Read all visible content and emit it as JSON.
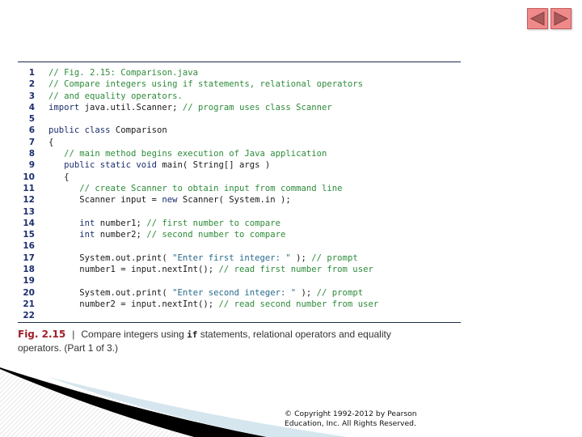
{
  "navigation": {
    "prev_icon": "triangle-left-icon",
    "next_icon": "triangle-right-icon",
    "button_color": "#f08a8a"
  },
  "code": {
    "lines": [
      {
        "n": "1",
        "tokens": [
          {
            "t": "cm",
            "v": "// Fig. 2.15: Comparison.java"
          }
        ]
      },
      {
        "n": "2",
        "tokens": [
          {
            "t": "cm",
            "v": "// Compare integers using if statements, relational operators"
          }
        ]
      },
      {
        "n": "3",
        "tokens": [
          {
            "t": "cm",
            "v": "// and equality operators."
          }
        ]
      },
      {
        "n": "4",
        "tokens": [
          {
            "t": "kw",
            "v": "import"
          },
          {
            "t": "tx",
            "v": " java.util.Scanner; "
          },
          {
            "t": "cm",
            "v": "// program uses class Scanner"
          }
        ]
      },
      {
        "n": "5",
        "tokens": []
      },
      {
        "n": "6",
        "tokens": [
          {
            "t": "kw",
            "v": "public class"
          },
          {
            "t": "tx",
            "v": " Comparison"
          }
        ]
      },
      {
        "n": "7",
        "tokens": [
          {
            "t": "tx",
            "v": "{"
          }
        ]
      },
      {
        "n": "8",
        "tokens": [
          {
            "t": "tx",
            "v": "   "
          },
          {
            "t": "cm",
            "v": "// main method begins execution of Java application"
          }
        ]
      },
      {
        "n": "9",
        "tokens": [
          {
            "t": "tx",
            "v": "   "
          },
          {
            "t": "kw",
            "v": "public static void"
          },
          {
            "t": "tx",
            "v": " main( String[] args )"
          }
        ]
      },
      {
        "n": "10",
        "tokens": [
          {
            "t": "tx",
            "v": "   {"
          }
        ]
      },
      {
        "n": "11",
        "tokens": [
          {
            "t": "tx",
            "v": "      "
          },
          {
            "t": "cm",
            "v": "// create Scanner to obtain input from command line"
          }
        ]
      },
      {
        "n": "12",
        "tokens": [
          {
            "t": "tx",
            "v": "      Scanner input = "
          },
          {
            "t": "kw",
            "v": "new"
          },
          {
            "t": "tx",
            "v": " Scanner( System.in );"
          }
        ]
      },
      {
        "n": "13",
        "tokens": []
      },
      {
        "n": "14",
        "tokens": [
          {
            "t": "tx",
            "v": "      "
          },
          {
            "t": "kw",
            "v": "int"
          },
          {
            "t": "tx",
            "v": " number1; "
          },
          {
            "t": "cm",
            "v": "// first number to compare"
          }
        ]
      },
      {
        "n": "15",
        "tokens": [
          {
            "t": "tx",
            "v": "      "
          },
          {
            "t": "kw",
            "v": "int"
          },
          {
            "t": "tx",
            "v": " number2; "
          },
          {
            "t": "cm",
            "v": "// second number to compare"
          }
        ]
      },
      {
        "n": "16",
        "tokens": []
      },
      {
        "n": "17",
        "tokens": [
          {
            "t": "tx",
            "v": "      System.out.print( "
          },
          {
            "t": "st",
            "v": "\"Enter first integer: \""
          },
          {
            "t": "tx",
            "v": " ); "
          },
          {
            "t": "cm",
            "v": "// prompt"
          }
        ]
      },
      {
        "n": "18",
        "tokens": [
          {
            "t": "tx",
            "v": "      number1 = input.nextInt(); "
          },
          {
            "t": "cm",
            "v": "// read first number from user"
          }
        ]
      },
      {
        "n": "19",
        "tokens": []
      },
      {
        "n": "20",
        "tokens": [
          {
            "t": "tx",
            "v": "      System.out.print( "
          },
          {
            "t": "st",
            "v": "\"Enter second integer: \""
          },
          {
            "t": "tx",
            "v": " ); "
          },
          {
            "t": "cm",
            "v": "// prompt"
          }
        ]
      },
      {
        "n": "21",
        "tokens": [
          {
            "t": "tx",
            "v": "      number2 = input.nextInt(); "
          },
          {
            "t": "cm",
            "v": "// read second number from user"
          }
        ]
      },
      {
        "n": "22",
        "tokens": []
      }
    ]
  },
  "caption": {
    "fig_label": "Fig. 2.15",
    "separator": "|",
    "text_before": "Compare integers using ",
    "code_word": "if",
    "text_after": " statements, relational operators and equality operators. (Part 1 of 3.)"
  },
  "footer": {
    "copyright_line1": "© Copyright 1992-2012 by Pearson",
    "copyright_line2": "Education, Inc. All Rights Reserved."
  },
  "colors": {
    "keyword": "#1c2e6e",
    "comment": "#2e8b3a",
    "string": "#2a6a8c",
    "line_number": "#1c2e6e",
    "fig_label": "#a0202a"
  }
}
